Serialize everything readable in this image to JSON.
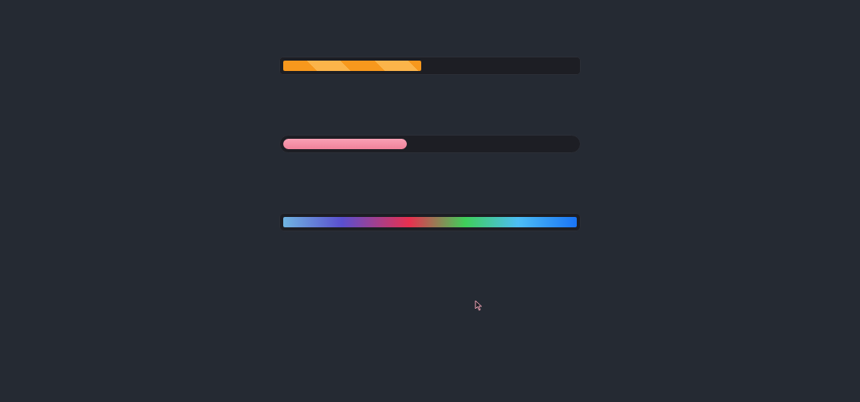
{
  "progress_bars": [
    {
      "kind": "striped",
      "level": 0.47
    },
    {
      "kind": "rounded",
      "level": 0.42
    },
    {
      "kind": "gradient",
      "level": 1
    }
  ]
}
